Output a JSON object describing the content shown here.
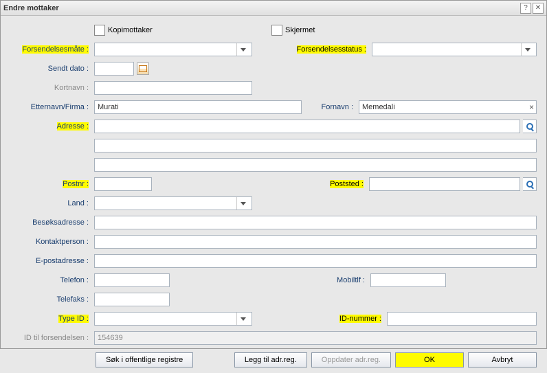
{
  "window": {
    "title": "Endre mottaker"
  },
  "checks": {
    "kopimottaker_label": "Kopimottaker",
    "skjermet_label": "Skjermet"
  },
  "labels": {
    "forsendelsesmate": "Forsendelsesmåte :",
    "forsendelsesstatus": "Forsendelsesstatus :",
    "sendt_dato": "Sendt dato :",
    "kortnavn": "Kortnavn :",
    "etternavn_firma": "Etternavn/Firma :",
    "fornavn": "Fornavn :",
    "adresse": "Adresse :",
    "postnr": "Postnr :",
    "poststed": "Poststed :",
    "land": "Land :",
    "besoksadresse": "Besøksadresse :",
    "kontaktperson": "Kontaktperson :",
    "epostadresse": "E-postadresse :",
    "telefon": "Telefon :",
    "mobiltlf": "Mobiltlf :",
    "telefaks": "Telefaks :",
    "type_id": "Type ID :",
    "id_nummer": "ID-nummer :",
    "id_forsendelsen": "ID til forsendelsen :"
  },
  "values": {
    "forsendelsesmate": "",
    "forsendelsesstatus": "",
    "sendt_dato": "",
    "kortnavn": "",
    "etternavn_firma": "Murati",
    "fornavn": "Memedali",
    "adresse1": "",
    "adresse2": "",
    "adresse3": "",
    "postnr": "",
    "poststed": "",
    "land": "",
    "besoksadresse": "",
    "kontaktperson": "",
    "epostadresse": "",
    "telefon": "",
    "mobiltlf": "",
    "telefaks": "",
    "type_id": "",
    "id_nummer": "",
    "id_forsendelsen": "154639"
  },
  "buttons": {
    "sok_registre": "Søk i offentlige registre",
    "legg_til": "Legg til adr.reg.",
    "oppdater": "Oppdater adr.reg.",
    "ok": "OK",
    "avbryt": "Avbryt"
  }
}
